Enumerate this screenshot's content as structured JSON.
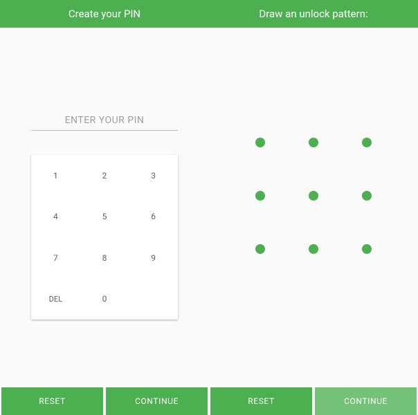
{
  "colors": {
    "brand": "#4caf50",
    "brand_light": "#74c278"
  },
  "header": {
    "pin_title": "Create your PIN",
    "pattern_title": "Draw an unlock pattern:"
  },
  "pin": {
    "placeholder": "ENTER YOUR PIN",
    "keys": [
      "1",
      "2",
      "3",
      "4",
      "5",
      "6",
      "7",
      "8",
      "9",
      "DEL",
      "0"
    ]
  },
  "pattern": {
    "dot_count": 9
  },
  "footer": {
    "pin_reset": "RESET",
    "pin_continue": "CONTINUE",
    "pattern_reset": "RESET",
    "pattern_continue": "CONTINUE"
  }
}
